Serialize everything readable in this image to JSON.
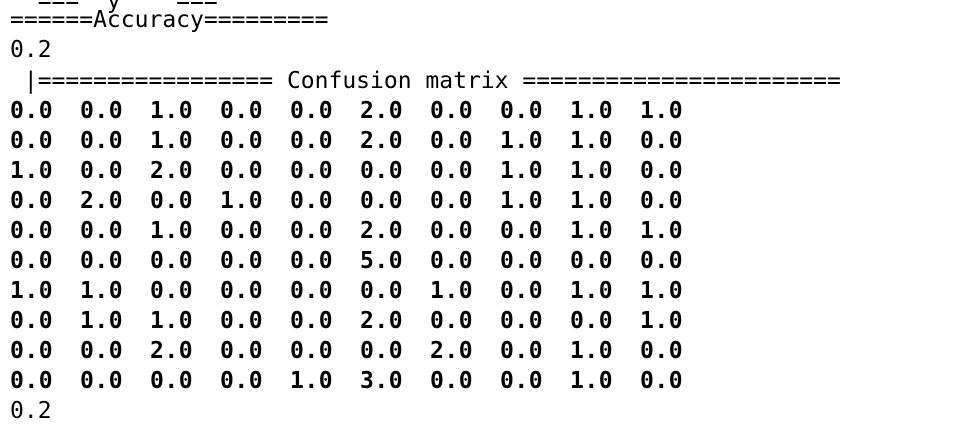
{
  "terminal": {
    "cut_text": "  ===  y    ===",
    "accuracy_heading": "======Accuracy=========",
    "accuracy_value": "0.2",
    "confusion_heading": " |================= Confusion matrix =======================",
    "final_value": "0.2",
    "matrix": [
      [
        "0.0",
        "0.0",
        "1.0",
        "0.0",
        "0.0",
        "2.0",
        "0.0",
        "0.0",
        "1.0",
        "1.0"
      ],
      [
        "0.0",
        "0.0",
        "1.0",
        "0.0",
        "0.0",
        "2.0",
        "0.0",
        "1.0",
        "1.0",
        "0.0"
      ],
      [
        "1.0",
        "0.0",
        "2.0",
        "0.0",
        "0.0",
        "0.0",
        "0.0",
        "1.0",
        "1.0",
        "0.0"
      ],
      [
        "0.0",
        "2.0",
        "0.0",
        "1.0",
        "0.0",
        "0.0",
        "0.0",
        "1.0",
        "1.0",
        "0.0"
      ],
      [
        "0.0",
        "0.0",
        "1.0",
        "0.0",
        "0.0",
        "2.0",
        "0.0",
        "0.0",
        "1.0",
        "1.0"
      ],
      [
        "0.0",
        "0.0",
        "0.0",
        "0.0",
        "0.0",
        "5.0",
        "0.0",
        "0.0",
        "0.0",
        "0.0"
      ],
      [
        "1.0",
        "1.0",
        "0.0",
        "0.0",
        "0.0",
        "0.0",
        "1.0",
        "0.0",
        "1.0",
        "1.0"
      ],
      [
        "0.0",
        "1.0",
        "1.0",
        "0.0",
        "0.0",
        "2.0",
        "0.0",
        "0.0",
        "0.0",
        "1.0"
      ],
      [
        "0.0",
        "0.0",
        "2.0",
        "0.0",
        "0.0",
        "0.0",
        "2.0",
        "0.0",
        "1.0",
        "0.0"
      ],
      [
        "0.0",
        "0.0",
        "0.0",
        "0.0",
        "1.0",
        "3.0",
        "0.0",
        "0.0",
        "1.0",
        "0.0"
      ]
    ]
  }
}
